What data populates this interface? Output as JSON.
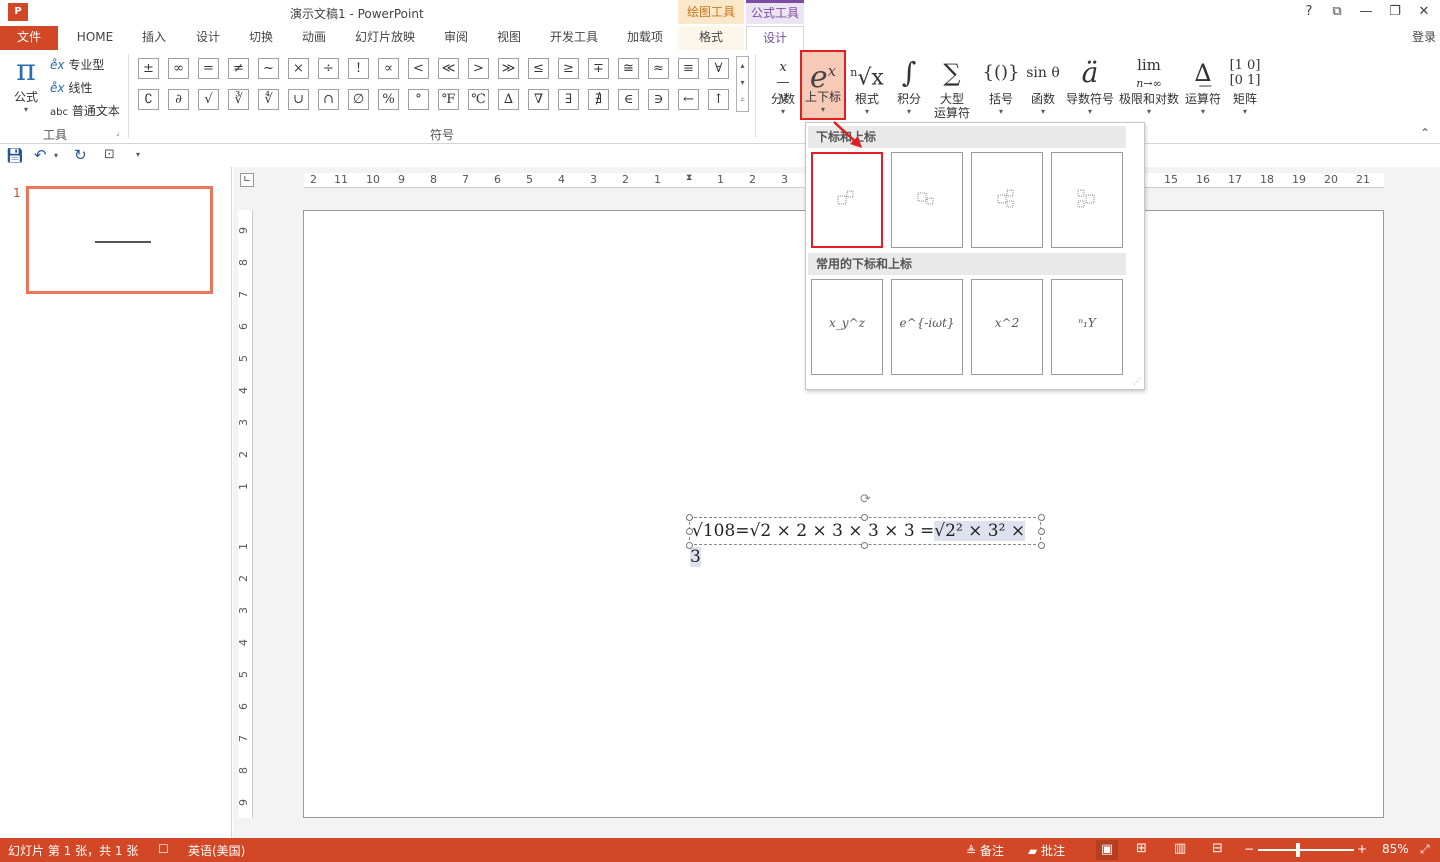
{
  "window": {
    "title": "演示文稿1 - PowerPoint",
    "controls": [
      "?",
      "⧉",
      "—",
      "❐",
      "✕"
    ],
    "login": "登录"
  },
  "context_tabs": {
    "drawing_tools": "绘图工具",
    "equation_tools": "公式工具"
  },
  "tabs": {
    "file": "文件",
    "items": [
      "HOME",
      "插入",
      "设计",
      "切换",
      "动画",
      "幻灯片放映",
      "审阅",
      "视图",
      "开发工具",
      "加载项",
      "格式",
      "设计"
    ]
  },
  "tools_group": {
    "equation_label": "公式",
    "professional": "专业型",
    "linear": "线性",
    "normal_text": "普通文本",
    "group_label": "工具"
  },
  "symbols_group": {
    "row1": [
      "±",
      "∞",
      "=",
      "≠",
      "~",
      "×",
      "÷",
      "!",
      "∝",
      "<",
      "≪",
      ">",
      "≫",
      "≤",
      "≥",
      "∓",
      "≅",
      "≈",
      "≡",
      "∀"
    ],
    "row2": [
      "∁",
      "∂",
      "√",
      "∛",
      "∜",
      "∪",
      "∩",
      "∅",
      "%",
      "°",
      "℉",
      "℃",
      "∆",
      "∇",
      "∃",
      "∄",
      "∈",
      "∋",
      "←",
      "↑"
    ],
    "group_label": "符号"
  },
  "structures": [
    {
      "label": "分数",
      "glyph": "x/y"
    },
    {
      "label": "上下标",
      "glyph": "eˣ"
    },
    {
      "label": "根式",
      "glyph": "ⁿ√x"
    },
    {
      "label": "积分",
      "glyph": "∫"
    },
    {
      "label": "大型\n运算符",
      "glyph": "∑"
    },
    {
      "label": "括号",
      "glyph": "{()}"
    },
    {
      "label": "函数",
      "glyph": "sinθ"
    },
    {
      "label": "导数符号",
      "glyph": "ä"
    },
    {
      "label": "极限和对数",
      "glyph": "lim"
    },
    {
      "label": "运算符",
      "glyph": "Δ"
    },
    {
      "label": "矩阵",
      "glyph": "[10]"
    }
  ],
  "gallery": {
    "section1_title": "下标和上标",
    "section2_title": "常用的下标和上标",
    "common_items": [
      "x_y^z",
      "e^{-iωt}",
      "x^2",
      "ⁿ₁Y"
    ]
  },
  "thumbnail": {
    "number": "1"
  },
  "ruler": {
    "horizontal": [
      "2",
      "11",
      "10",
      "9",
      "8",
      "7",
      "6",
      "5",
      "4",
      "3",
      "2",
      "1",
      "1",
      "2",
      "3",
      "15",
      "16",
      "17",
      "18",
      "19",
      "20",
      "21"
    ],
    "vertical": [
      "9",
      "8",
      "7",
      "6",
      "5",
      "4",
      "3",
      "2",
      "1",
      "1",
      "2",
      "3",
      "4",
      "5",
      "6",
      "7",
      "8",
      "9"
    ]
  },
  "equation": {
    "part1": "√108=√2 × 2 × 3 × 3 × 3 =",
    "part2": "√2² × 3² × 3"
  },
  "status": {
    "slide_info": "幻灯片 第 1 张，共 1 张",
    "language": "英语(美国)",
    "notes": "备注",
    "comments": "批注",
    "zoom": "85%"
  },
  "colors": {
    "accent": "#d24726",
    "highlight_box": "#e02020",
    "equation_tools_tab": "#7b4ea3",
    "drawing_tools_tab": "#e8a33d"
  }
}
